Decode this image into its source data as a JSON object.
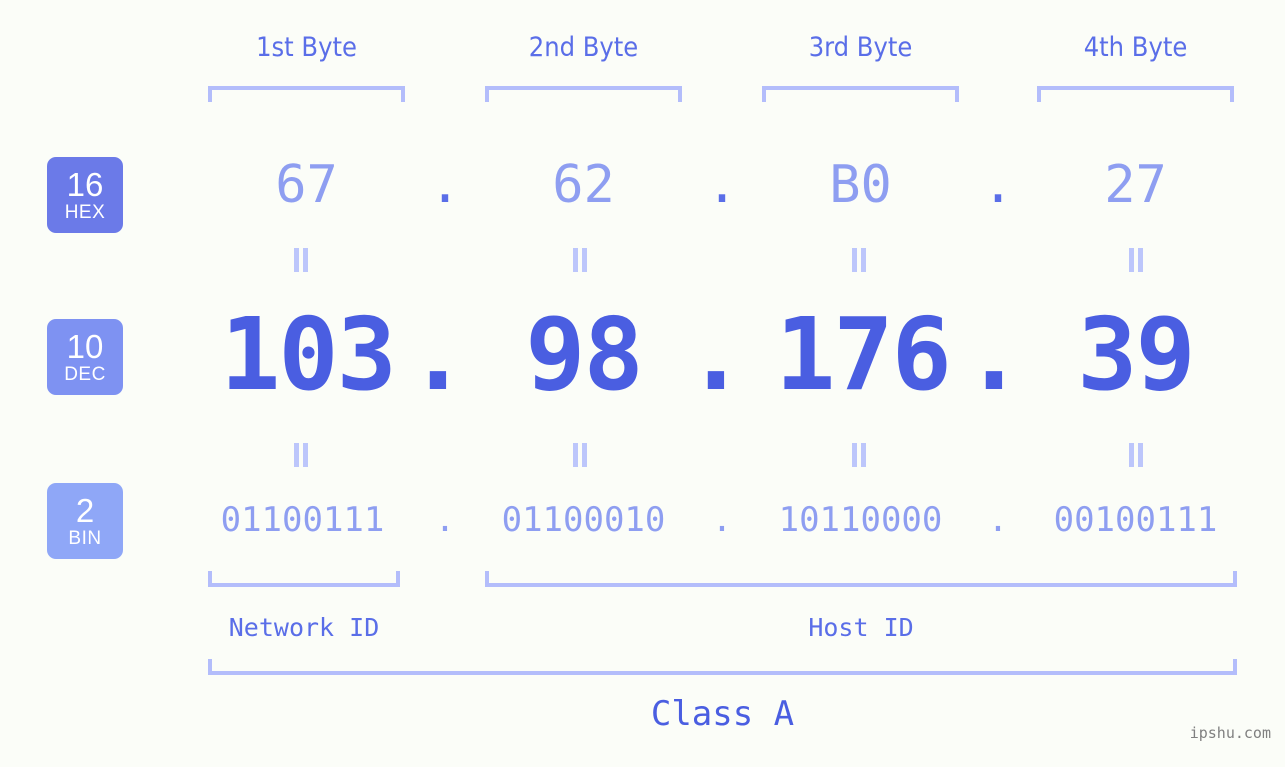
{
  "page": {
    "watermark": "ipshu.com",
    "background_color": "#fbfdf8",
    "accent_color": "#4a5ee1",
    "accent_light_color": "#8e9ef1",
    "bracket_color": "#b3bdfb"
  },
  "byte_headers": [
    {
      "label": "1st Byte"
    },
    {
      "label": "2nd Byte"
    },
    {
      "label": "3rd Byte"
    },
    {
      "label": "4th Byte"
    }
  ],
  "radix_badges": [
    {
      "number": "16",
      "name": "HEX",
      "color": "#6b7ae8"
    },
    {
      "number": "10",
      "name": "DEC",
      "color": "#7e92f2"
    },
    {
      "number": "2",
      "name": "BIN",
      "color": "#8fa7f7"
    }
  ],
  "rows": {
    "hex": {
      "radix": "16",
      "label": "HEX",
      "octets": [
        "67",
        "62",
        "B0",
        "27"
      ],
      "separator": "."
    },
    "dec": {
      "radix": "10",
      "label": "DEC",
      "octets": [
        "103",
        "98",
        "176",
        "39"
      ],
      "separator": "."
    },
    "bin": {
      "radix": "2",
      "label": "BIN",
      "octets": [
        "01100111",
        "01100010",
        "10110000",
        "00100111"
      ],
      "separator": "."
    }
  },
  "equals_marks": {
    "symbol": "=",
    "count": 8
  },
  "partitions": {
    "network_id": {
      "label": "Network ID"
    },
    "host_id": {
      "label": "Host ID"
    },
    "class": {
      "label": "Class A"
    }
  }
}
